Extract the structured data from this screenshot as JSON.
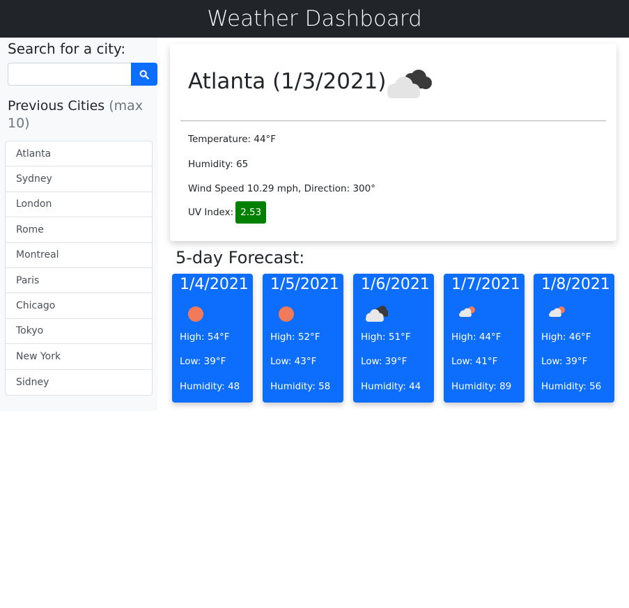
{
  "header": {
    "title": "Weather Dashboard"
  },
  "search": {
    "title": "Search for a city:",
    "placeholder": "",
    "value": ""
  },
  "previous": {
    "title": "Previous Cities",
    "note": "(max 10)",
    "cities": [
      "Atlanta",
      "Sydney",
      "London",
      "Rome",
      "Montreal",
      "Paris",
      "Chicago",
      "Tokyo",
      "New York",
      "Sidney"
    ]
  },
  "current": {
    "title": "Atlanta (1/3/2021)",
    "icon": "cloudy-icon",
    "temperature": "Temperature: 44°F",
    "humidity": "Humidity: 65",
    "wind": "Wind Speed 10.29 mph, Direction: 300°",
    "uv_label": "UV Index:",
    "uv_value": "2.53",
    "uv_color": "#008000"
  },
  "forecast": {
    "title": "5-day Forecast:",
    "days": [
      {
        "date": "1/4/2021",
        "icon": "sun-icon",
        "high": "High: 54°F",
        "low": "Low: 39°F",
        "humidity": "Humidity: 48"
      },
      {
        "date": "1/5/2021",
        "icon": "sun-icon",
        "high": "High: 52°F",
        "low": "Low: 43°F",
        "humidity": "Humidity: 58"
      },
      {
        "date": "1/6/2021",
        "icon": "cloudy-icon",
        "high": "High: 51°F",
        "low": "Low: 39°F",
        "humidity": "Humidity: 44"
      },
      {
        "date": "1/7/2021",
        "icon": "rain-sun-icon",
        "high": "High: 44°F",
        "low": "Low: 41°F",
        "humidity": "Humidity: 89"
      },
      {
        "date": "1/8/2021",
        "icon": "rain-sun-icon",
        "high": "High: 46°F",
        "low": "Low: 39°F",
        "humidity": "Humidity: 56"
      }
    ]
  },
  "colors": {
    "accent": "#0d6efd",
    "header_bg": "#212529",
    "uv": "#008000"
  }
}
